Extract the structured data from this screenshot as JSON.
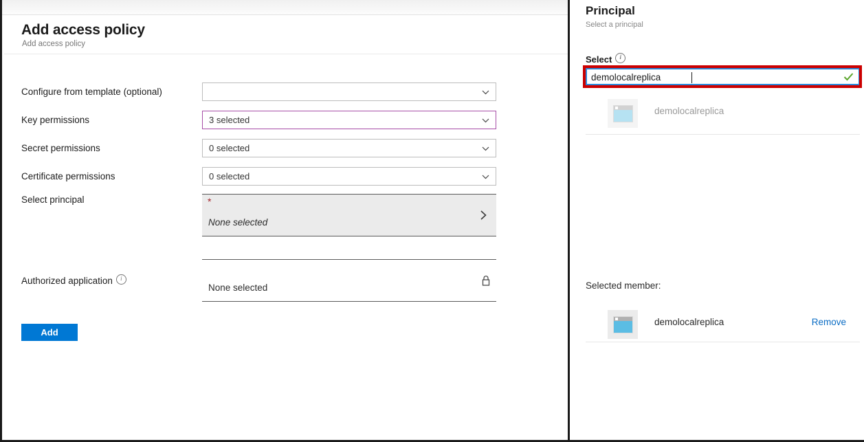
{
  "left_blade": {
    "title": "Add access policy",
    "subtitle": "Add access policy",
    "fields": {
      "template": {
        "label": "Configure from template (optional)",
        "value": ""
      },
      "key_permissions": {
        "label": "Key permissions",
        "value": "3 selected"
      },
      "secret_permissions": {
        "label": "Secret permissions",
        "value": "0 selected"
      },
      "certificate_permissions": {
        "label": "Certificate permissions",
        "value": "0 selected"
      },
      "select_principal": {
        "label": "Select principal",
        "required_marker": "*",
        "value": "None selected"
      },
      "authorized_application": {
        "label": "Authorized application",
        "value": "None selected"
      }
    },
    "add_button_label": "Add"
  },
  "right_blade": {
    "title": "Principal",
    "subtitle": "Select a principal",
    "select_label": "Select",
    "search": {
      "value": "demolocalreplica",
      "placeholder": ""
    },
    "results": [
      {
        "name": "demolocalreplica"
      }
    ],
    "selected_member_label": "Selected member:",
    "selected_members": [
      {
        "name": "demolocalreplica",
        "remove_label": "Remove"
      }
    ]
  },
  "colors": {
    "accent_blue": "#0078d4",
    "link_blue": "#0a6cc4",
    "focus_border": "#2b88d8",
    "annotation_red": "#cc0000",
    "validation_purple": "#a64ca6",
    "required_red": "#a4262c",
    "success_green": "#5aa52b"
  }
}
